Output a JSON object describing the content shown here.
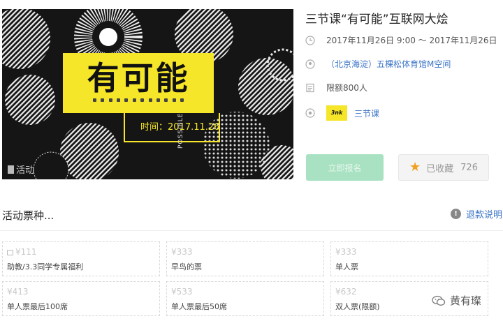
{
  "poster": {
    "title": "有可能",
    "date_text": "时间：2017.11.26",
    "vertical_text": "POSSIBLE",
    "logo_text": "活动"
  },
  "event": {
    "title": "三节课“有可能”互联网大烩",
    "time": "2017年11月26日 9:00 ～ 2017年11月26日",
    "location": "（北京海淀）五棵松体育馆M空间",
    "quota": "限额800人",
    "organizer": "三节课",
    "organizer_logo_text": "3nk"
  },
  "actions": {
    "ticket_button": "立即报名",
    "favorite_label": "已收藏",
    "favorite_count": "726"
  },
  "tickets_section": {
    "title": "活动票种...",
    "refund_label": "退款说明",
    "tickets": [
      {
        "price": "¥111",
        "name": "助教/3.3同学专属福利",
        "locked": true
      },
      {
        "price": "¥333",
        "name": "早鸟的票",
        "locked": false
      },
      {
        "price": "¥333",
        "name": "单人票",
        "locked": false
      },
      {
        "price": "¥413",
        "name": "单人票最后100席",
        "locked": false
      },
      {
        "price": "¥533",
        "name": "单人票最后50席",
        "locked": false
      },
      {
        "price": "¥632",
        "name": "双人票(限额)",
        "locked": false
      }
    ]
  },
  "watermark": {
    "text": "黄有璨"
  },
  "colors": {
    "accent_yellow": "#f5e629",
    "link_blue": "#3b74c6",
    "button_green": "#a8e2c2",
    "star_orange": "#f0a020"
  }
}
